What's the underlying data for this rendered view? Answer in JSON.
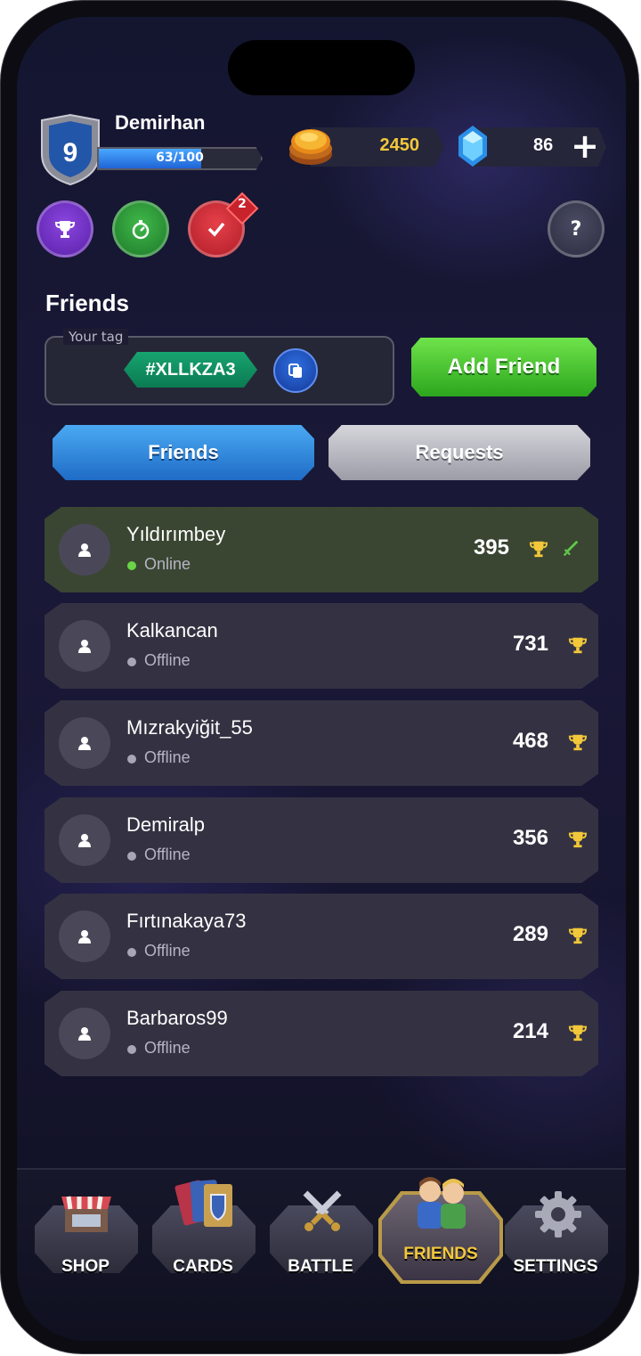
{
  "player": {
    "level": "9",
    "name": "Demirhan",
    "xp_text": "63/100",
    "xp_fraction": 0.63
  },
  "currency": {
    "coins": "2450",
    "gems": "86",
    "plus": "+"
  },
  "quick_buttons": {
    "help": "?",
    "notification_count": "2"
  },
  "friends_page": {
    "title": "Friends",
    "tag_label": "Your tag",
    "tag_value": "#XLLKZA3",
    "add_friend": "Add Friend",
    "tabs": {
      "friends": "Friends",
      "requests": "Requests"
    },
    "list": [
      {
        "name": "Yıldırımbey",
        "status": "Online",
        "trophies": "395",
        "active": true
      },
      {
        "name": "Kalkancan",
        "status": "Offline",
        "trophies": "731",
        "active": false
      },
      {
        "name": "Mızrakyiğit_55",
        "status": "Offline",
        "trophies": "468",
        "active": false
      },
      {
        "name": "Demiralp",
        "status": "Offline",
        "trophies": "356",
        "active": false
      },
      {
        "name": "Fırtınakaya73",
        "status": "Offline",
        "trophies": "289",
        "active": false
      },
      {
        "name": "Barbaros99",
        "status": "Offline",
        "trophies": "214",
        "active": false
      }
    ]
  },
  "nav": {
    "shop": "SHOP",
    "cards": "CARDS",
    "battle": "BATTLE",
    "friends": "FRIENDS",
    "settings": "SETTINGS",
    "selected": "friends"
  },
  "colors": {
    "online": "#6bd346",
    "offline": "#a8a6b4",
    "gold": "#f2c83a",
    "active_row": "#3a4632"
  }
}
